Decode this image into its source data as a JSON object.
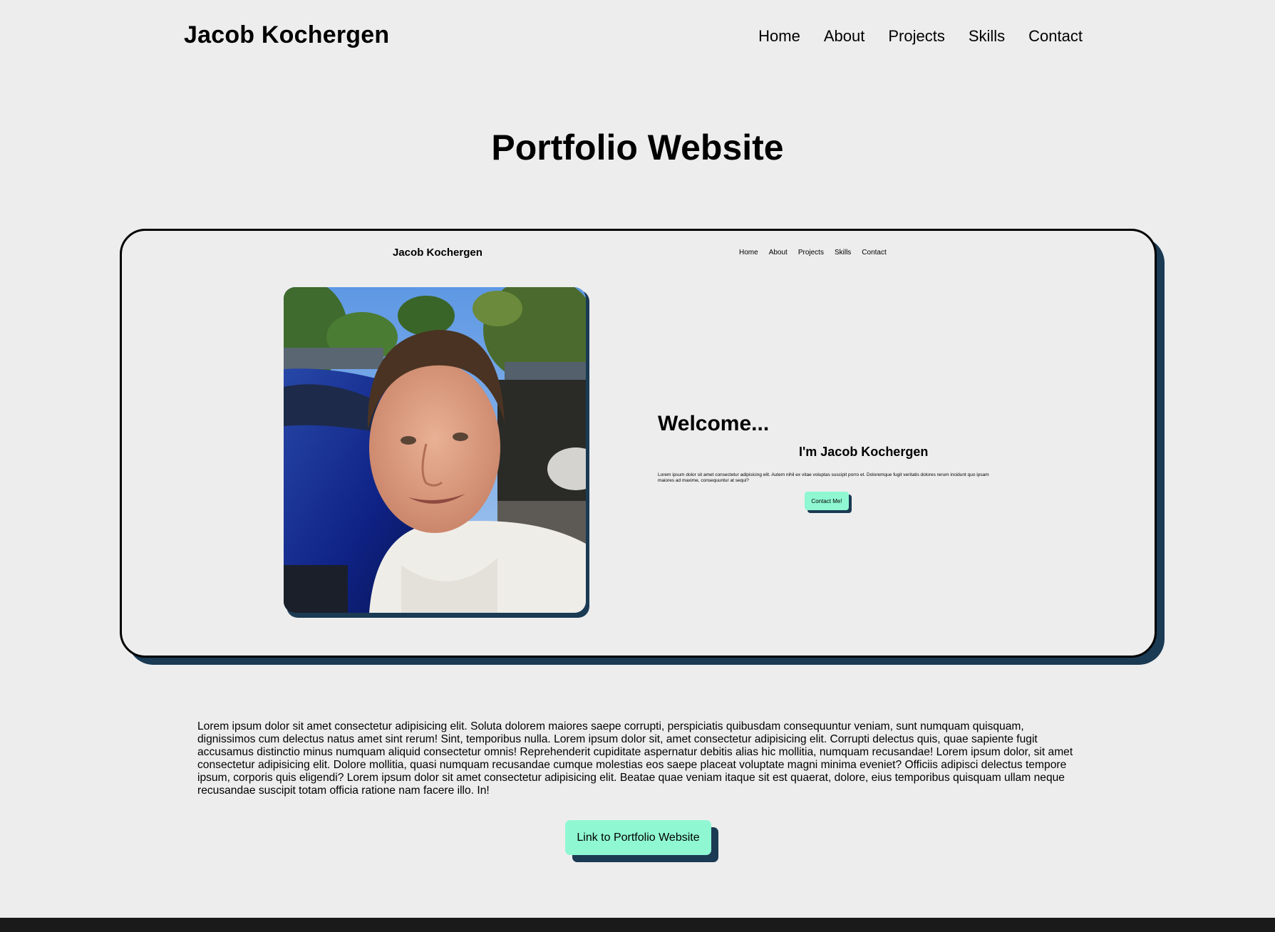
{
  "header": {
    "brand": "Jacob Kochergen",
    "nav": [
      "Home",
      "About",
      "Projects",
      "Skills",
      "Contact"
    ]
  },
  "main": {
    "title": "Portfolio Website",
    "preview": {
      "brand": "Jacob Kochergen",
      "nav": [
        "Home",
        "About",
        "Projects",
        "Skills",
        "Contact"
      ],
      "welcome": "Welcome...",
      "intro": "I'm Jacob Kochergen",
      "lorem": "Lorem ipsum dolor sit amet consectetur adipisicing elit. Autem nihil ex vitae voluptas suscipit porro et. Doloremque fugit veritatis dolores rerum incidunt quo ipsam maiores ad maxime, consequuntur at sequi?",
      "contact_button": "Contact Me!"
    },
    "description": "Lorem ipsum dolor sit amet consectetur adipisicing elit. Soluta dolorem maiores saepe corrupti, perspiciatis quibusdam consequuntur veniam, sunt numquam quisquam, dignissimos cum delectus natus amet sint rerum! Sint, temporibus nulla. Lorem ipsum dolor sit, amet consectetur adipisicing elit. Corrupti delectus quis, quae sapiente fugit accusamus distinctio minus numquam aliquid consectetur omnis! Reprehenderit cupiditate aspernatur debitis alias hic mollitia, numquam recusandae! Lorem ipsum dolor, sit amet consectetur adipisicing elit. Dolore mollitia, quasi numquam recusandae cumque molestias eos saepe placeat voluptate magni minima eveniet? Officiis adipisci delectus tempore ipsum, corporis quis eligendi? Lorem ipsum dolor sit amet consectetur adipisicing elit. Beatae quae veniam itaque sit est quaerat, dolore, eius temporibus quisquam ullam neque recusandae suscipit totam officia ratione nam facere illo. In!",
    "link_button": "Link to Portfolio Website"
  },
  "colors": {
    "background": "#ededed",
    "accent": "#8ff8d3",
    "shadow": "#1b3a53",
    "footer": "#1a1a1a"
  }
}
